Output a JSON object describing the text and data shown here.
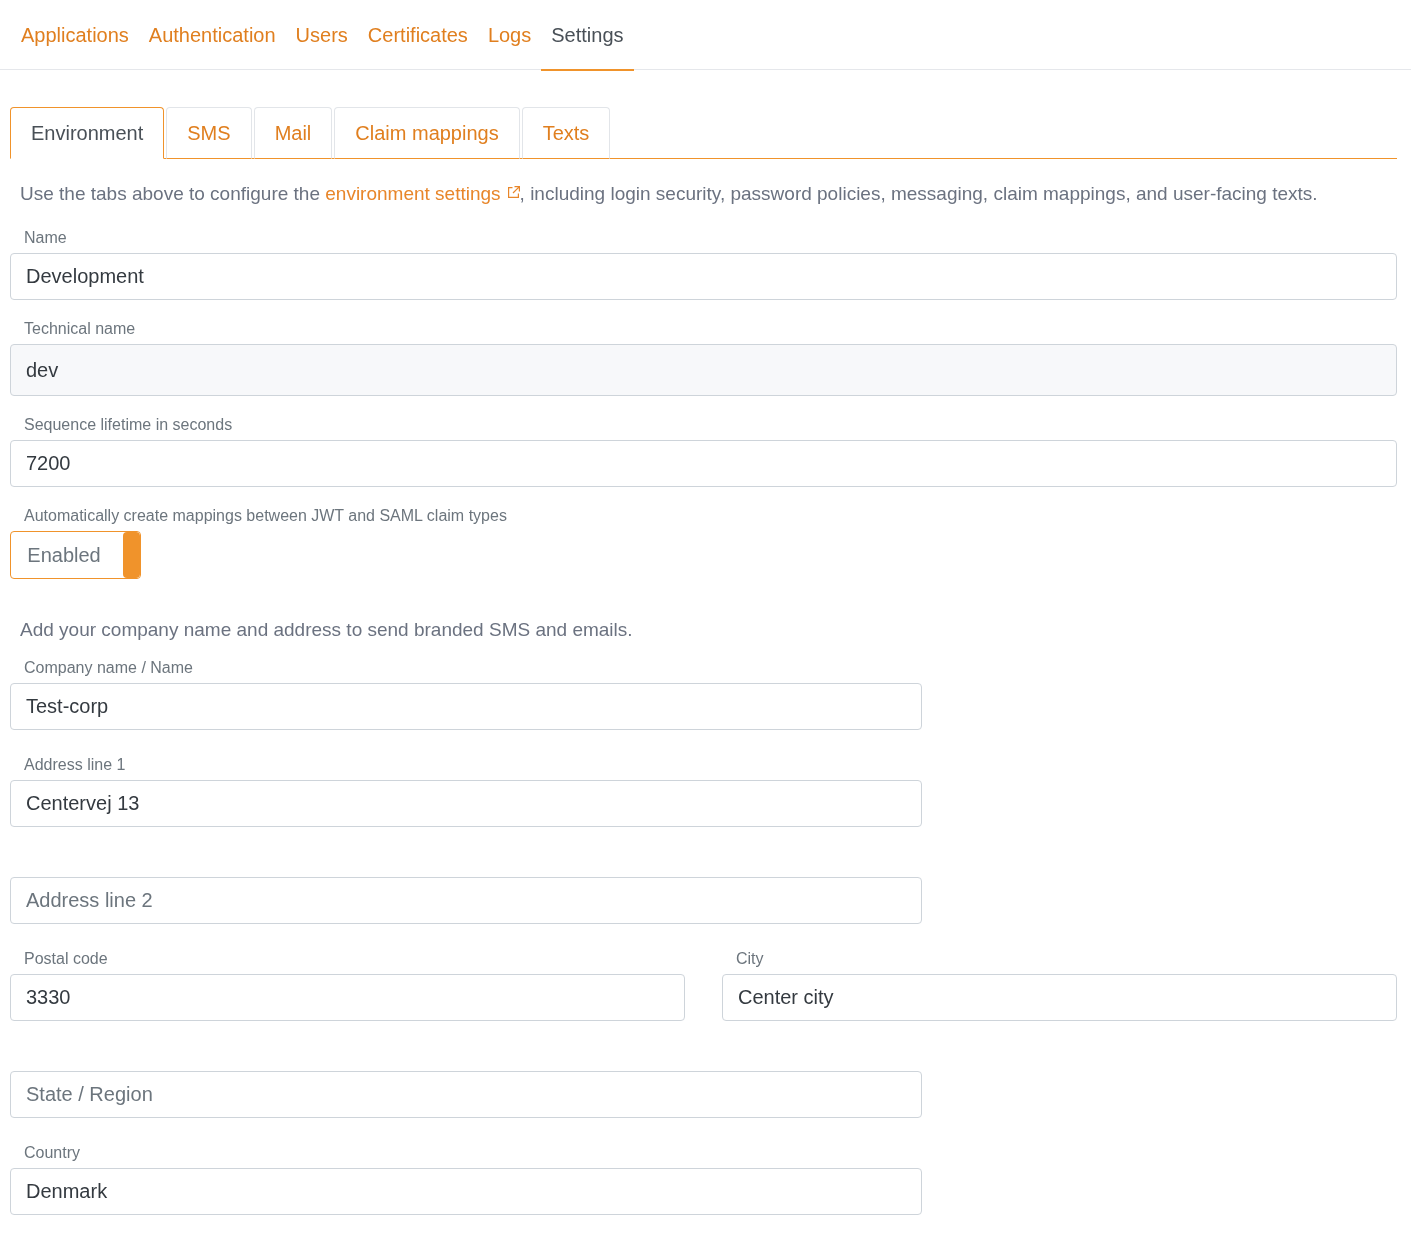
{
  "nav": [
    {
      "label": "Applications",
      "selected": false
    },
    {
      "label": "Authentication",
      "selected": false
    },
    {
      "label": "Users",
      "selected": false
    },
    {
      "label": "Certificates",
      "selected": false
    },
    {
      "label": "Logs",
      "selected": false
    },
    {
      "label": "Settings",
      "selected": true
    }
  ],
  "tabs": [
    {
      "label": "Environment",
      "selected": true
    },
    {
      "label": "SMS",
      "selected": false
    },
    {
      "label": "Mail",
      "selected": false
    },
    {
      "label": "Claim mappings",
      "selected": false
    },
    {
      "label": "Texts",
      "selected": false
    }
  ],
  "intro": {
    "before": "Use the tabs above to configure the ",
    "link": "environment settings",
    "after": ", including login security, password policies, messaging, claim mappings, and user-facing texts."
  },
  "environment_fields": [
    {
      "kind": "text",
      "label": "Name",
      "value": "Development",
      "disabled": false
    },
    {
      "kind": "text",
      "label": "Technical name",
      "value": "dev",
      "disabled": true
    },
    {
      "kind": "text",
      "label": "Sequence lifetime in seconds",
      "value": "7200",
      "disabled": false
    },
    {
      "kind": "toggle",
      "label": "Automatically create mappings between JWT and SAML claim types",
      "text": "Enabled",
      "on": true
    }
  ],
  "company": {
    "intro": "Add your company name and address to send branded SMS and emails.",
    "fields": [
      {
        "kind": "text",
        "label": "Company name / Name",
        "value": "Test-corp"
      },
      {
        "kind": "text",
        "label": "Address line 1",
        "value": "Centervej 13"
      },
      {
        "kind": "text",
        "placeholder": "Address line 2"
      },
      {
        "kind": "pair",
        "fields": [
          {
            "label": "Postal code",
            "value": "3330"
          },
          {
            "label": "City",
            "value": "Center city"
          }
        ]
      },
      {
        "kind": "text",
        "placeholder": "State / Region"
      },
      {
        "kind": "text",
        "label": "Country",
        "value": "Denmark"
      }
    ]
  }
}
